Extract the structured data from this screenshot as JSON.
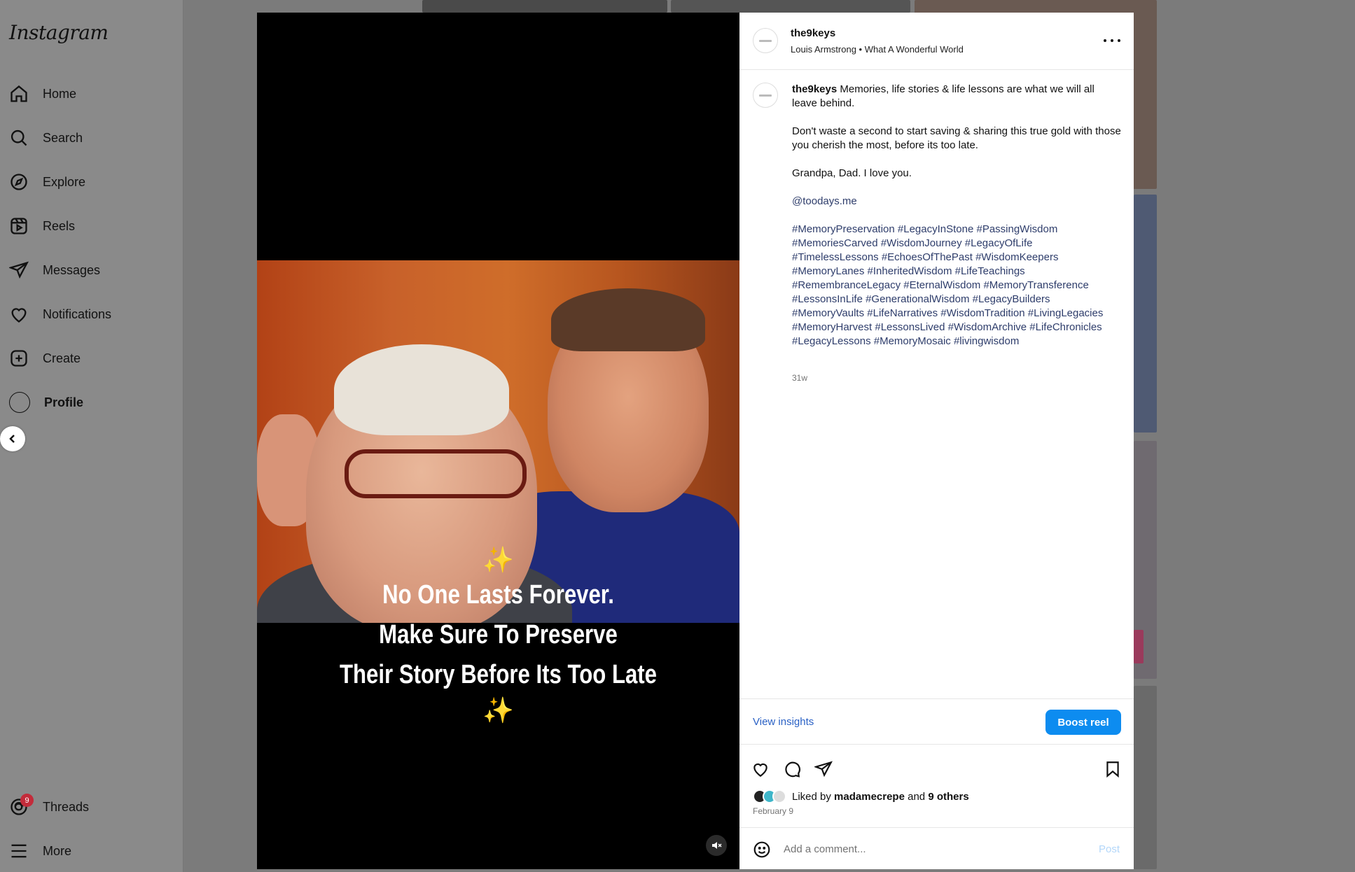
{
  "sidebar": {
    "logo": "Instagram",
    "items": [
      {
        "label": "Home",
        "icon": "home-icon"
      },
      {
        "label": "Search",
        "icon": "search-icon"
      },
      {
        "label": "Explore",
        "icon": "explore-icon"
      },
      {
        "label": "Reels",
        "icon": "reels-icon"
      },
      {
        "label": "Messages",
        "icon": "messages-icon"
      },
      {
        "label": "Notifications",
        "icon": "heart-icon"
      },
      {
        "label": "Create",
        "icon": "plus-square-icon"
      },
      {
        "label": "Profile",
        "icon": "avatar"
      }
    ],
    "threads": {
      "label": "Threads",
      "badge": "9"
    },
    "more": {
      "label": "More"
    }
  },
  "media": {
    "caption_lines": [
      "No One Lasts Forever.",
      "Make Sure To Preserve",
      "Their Story Before Its Too Late"
    ],
    "sparkle": "✨"
  },
  "post": {
    "username": "the9keys",
    "audio": "Louis Armstrong • What A Wonderful World",
    "caption": {
      "username": "the9keys",
      "first": " Memories, life stories & life lessons are what we will all leave behind.",
      "p2": "Don't waste a second to start saving & sharing this true gold with those you cherish the most, before its too late.",
      "p3": "Grandpa, Dad. I love you.",
      "mention": "@toodays.me",
      "hashtags": "#MemoryPreservation #LegacyInStone #PassingWisdom #MemoriesCarved #WisdomJourney #LegacyOfLife #TimelessLessons #EchoesOfThePast #WisdomKeepers #MemoryLanes #InheritedWisdom #LifeTeachings #RemembranceLegacy #EternalWisdom #MemoryTransference #LessonsInLife #GenerationalWisdom #LegacyBuilders #MemoryVaults #LifeNarratives #WisdomTradition #LivingLegacies #MemoryHarvest #LessonsLived #WisdomArchive #LifeChronicles #LegacyLessons #MemoryMosaic #livingwisdom"
    },
    "age": "31w",
    "view_insights": "View insights",
    "boost": "Boost reel",
    "likes": {
      "prefix": "Liked by ",
      "user": "madamecrepe",
      "and": " and ",
      "others": "9 others"
    },
    "date": "February 9",
    "comment_placeholder": "Add a comment...",
    "post_label": "Post"
  },
  "colors": {
    "accent": "#0d8cf0",
    "link": "#2e3d6b",
    "badge": "#c32b3a"
  }
}
